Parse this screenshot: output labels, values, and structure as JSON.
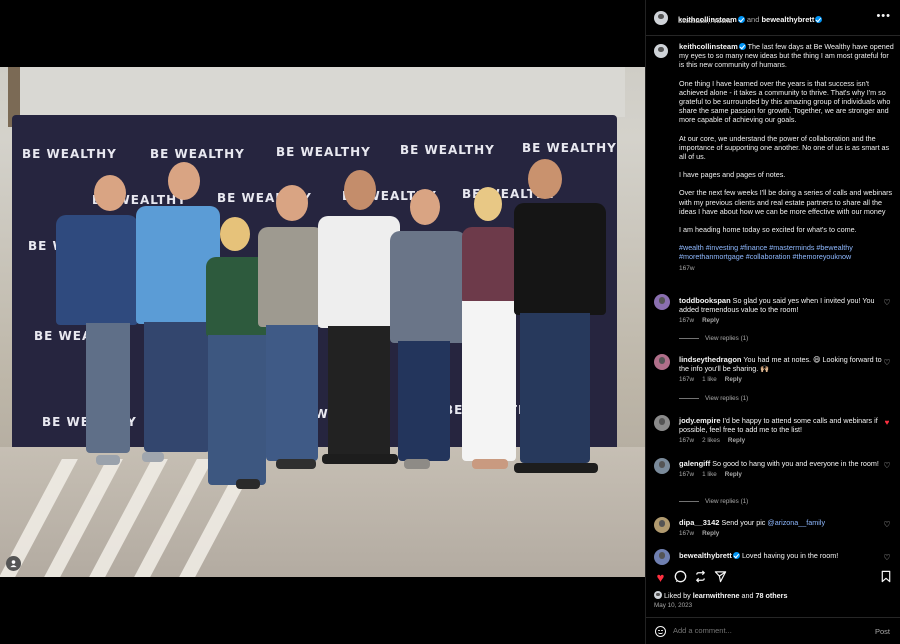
{
  "header": {
    "user1": "keithcollinsteam",
    "and_text": " and ",
    "user2": "bewealthybrett",
    "location": "Scottsdale, Arizona",
    "more_icon": "more-horizontal-icon"
  },
  "photo": {
    "backdrop_brand": "BE WEALTHY",
    "backdrop_color": "#26253f"
  },
  "caption": {
    "username": "keithcollinsteam",
    "p1": "The last few days at Be Wealthy have opened my eyes to so many new ideas but the thing I am most grateful for is this new community of humans.",
    "p2": "One thing I have learned over the years is that success isn't achieved alone - it takes a community to thrive. That's why I'm so grateful to be surrounded by this amazing group of individuals who share the same passion for growth. Together, we are stronger and more capable of achieving our goals.",
    "p3": "At our core, we understand the power of collaboration and the importance of supporting one another. No one of us is as smart as all of us.",
    "p4": "I have pages and pages of notes.",
    "p5": "Over the next few weeks I'll be doing a series of calls and webinars with my previous clients and real estate partners to share all the ideas I have about how we can be more effective with our money",
    "p6": "I am heading home today so excited for what's to come.",
    "tags": "#wealth #investing #finance #masterminds #bewealthy #morethanmortgage #collaboration #themoreyouknow",
    "time": "167w"
  },
  "comments": [
    {
      "user": "toddbookspan",
      "text": "So glad you said yes when I invited you! You added tremendous value to the room!",
      "time": "167w",
      "likes": "",
      "reply": "Reply",
      "replies": "View replies (1)"
    },
    {
      "user": "lindseythedragon",
      "text": "You had me at notes. 😄 Looking forward to the info you'll be sharing. 🙌🏼",
      "time": "167w",
      "likes": "1 like",
      "reply": "Reply",
      "replies": "View replies (1)"
    },
    {
      "user": "jody.empire",
      "text": "I'd be happy to attend some calls and webinars if possible, feel free to add me to the list!",
      "time": "167w",
      "likes": "2 likes",
      "reply": "Reply",
      "replies": ""
    },
    {
      "user": "galengiff",
      "text": "So good to hang with you and everyone in the room!",
      "time": "167w",
      "likes": "1 like",
      "reply": "Reply",
      "replies": "View replies (1)"
    },
    {
      "user": "dipa__3142",
      "text": "Send your pic ",
      "mention": "@arizona__family",
      "time": "167w",
      "likes": "",
      "reply": "Reply",
      "replies": ""
    },
    {
      "user": "bewealthybrett",
      "text": "Loved having you in the room!",
      "time": "",
      "likes": "",
      "reply": "",
      "replies": ""
    }
  ],
  "actions": {
    "like_icon": "heart-filled-icon",
    "comment_icon": "comment-icon",
    "share_icon": "repost-icon",
    "send_icon": "send-icon",
    "save_icon": "bookmark-icon",
    "like_color": "#ff3040"
  },
  "likes": {
    "prefix": "Liked by ",
    "user": "learnwithrene",
    "middle": " and ",
    "others": "78 others"
  },
  "date": "May 10, 2023",
  "add_comment": {
    "placeholder": "Add a comment...",
    "post": "Post"
  }
}
